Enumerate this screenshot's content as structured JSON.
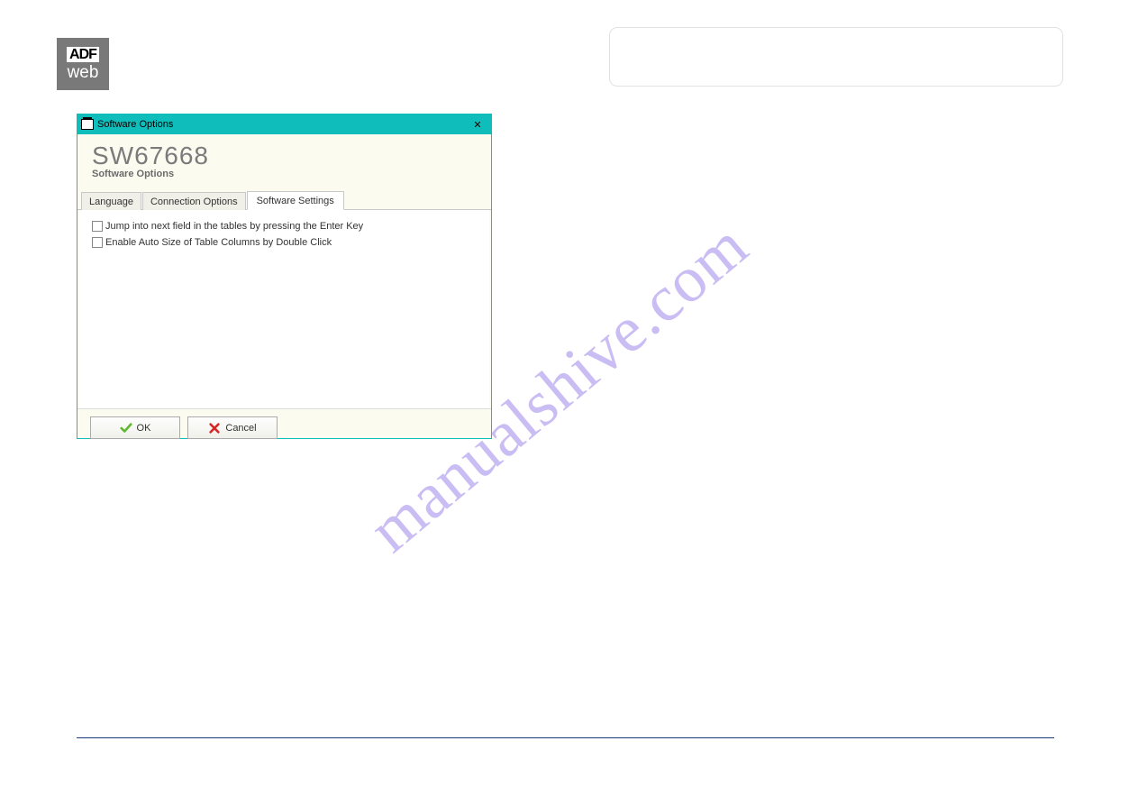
{
  "watermark": "manualshive.com",
  "logo": {
    "top": "ADF",
    "bottom": "web"
  },
  "dialog": {
    "title": "Software Options",
    "sw_title": "SW67668",
    "sw_subtitle": "Software Options",
    "tabs": {
      "language": "Language",
      "connection": "Connection Options",
      "software": "Software Settings"
    },
    "checkbox1": "Jump into next field in the tables by pressing the Enter Key",
    "checkbox2": "Enable Auto Size of Table Columns by Double Click",
    "ok_label": "OK",
    "cancel_label": "Cancel"
  }
}
